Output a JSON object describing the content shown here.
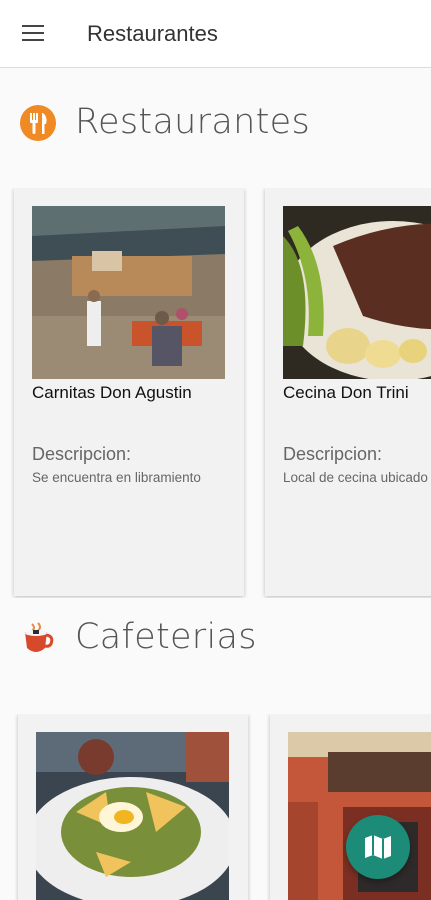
{
  "appbar": {
    "title": "Restaurantes",
    "menu_icon": "hamburger-menu-icon"
  },
  "sections": [
    {
      "title": "Restaurantes",
      "icon": "fork-knife-icon",
      "cards": [
        {
          "name": "Carnitas Don Agustin",
          "desc_label": "Descripcion:",
          "desc": "Se encuentra en libramiento"
        },
        {
          "name": "Cecina Don Trini",
          "desc_label": "Descripcion:",
          "desc": "Local de cecina ubicado en Tepetlixpa"
        }
      ]
    },
    {
      "title": "Cafeterias",
      "icon": "coffee-cup-icon",
      "cards": [
        {
          "name": "",
          "desc_label": "",
          "desc": ""
        },
        {
          "name": "",
          "desc_label": "",
          "desc": ""
        }
      ]
    }
  ],
  "fab": {
    "icon": "map-icon"
  },
  "colors": {
    "accent": "#1c8b78",
    "restaurant_icon": "#f08a24",
    "cafe_icon": "#d64a2b"
  }
}
